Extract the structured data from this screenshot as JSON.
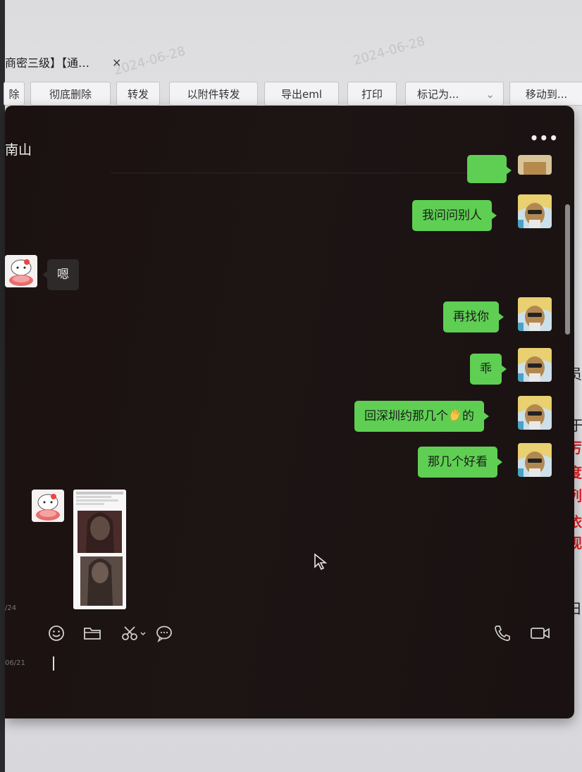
{
  "background_mail": {
    "tab_title": "商密三级】【通…",
    "close_symbol": "×",
    "watermark": "2024-06-28",
    "toolbar": {
      "delete_partial": "除",
      "permanent_delete": "彻底删除",
      "forward": "转发",
      "forward_as_attachment": "以附件转发",
      "export_eml": "导出eml",
      "print": "打印",
      "mark_as": "标记为...",
      "move_to": "移动到..."
    },
    "right_edge_text": [
      "员",
      "于",
      "厉",
      "度",
      "列",
      "依",
      "视",
      "日"
    ]
  },
  "chat": {
    "contact_name": "南山",
    "more_label": "•••",
    "messages": [
      {
        "side": "right",
        "text": "我问问别人"
      },
      {
        "side": "left",
        "text": "嗯"
      },
      {
        "side": "right",
        "text": "再找你"
      },
      {
        "side": "right",
        "text": "乖"
      },
      {
        "side": "right",
        "text_before": "回深圳约那几个",
        "emoji": "waving-hand",
        "text_after": "的"
      },
      {
        "side": "right",
        "text": "那几个好看"
      }
    ],
    "side_dates": [
      "/24",
      "06/21"
    ],
    "input_toolbar": [
      "emoji-icon",
      "folder-icon",
      "scissors-icon",
      "chat-bubble-icon",
      "phone-icon",
      "video-icon"
    ],
    "colors": {
      "bubble_right": "#5fcf53",
      "bubble_left": "#2e2a2a",
      "window_bg": "#1b1111"
    }
  }
}
